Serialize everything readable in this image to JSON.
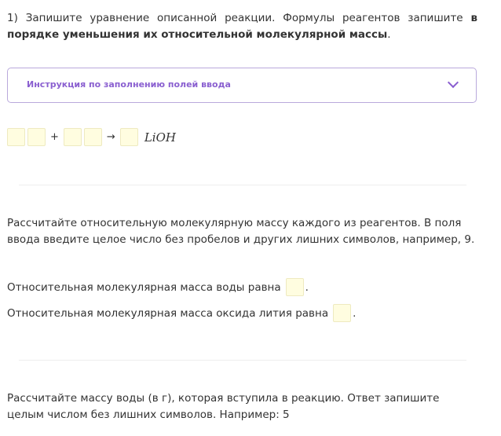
{
  "q1": {
    "text_start": "1) Запишите уравнение описанной реакции. Формулы реагентов запишите ",
    "text_bold": "в порядке уменьшения их относительной молекулярной массы",
    "text_end": "."
  },
  "instruction": {
    "label": "Инструкция по заполнению полей ввода",
    "icon": "chevron-down-icon",
    "color": "#8a5fd0"
  },
  "equation": {
    "plus": "+",
    "arrow": "→",
    "product": "LiOH"
  },
  "q2": {
    "text": "Рассчитайте относительную молекулярную массу каждого из реагентов. В поля ввода введите целое число без пробелов и других лишних символов, например, 9.",
    "line1": "Относительная молекулярная масса воды равна",
    "line2": "Относительная молекулярная масса оксида лития равна",
    "dot": "."
  },
  "q3": {
    "text": "Рассчитайте массу воды (в г), которая вступила в реакцию. Ответ запишите целым числом без лишних символов. Например: 5"
  }
}
